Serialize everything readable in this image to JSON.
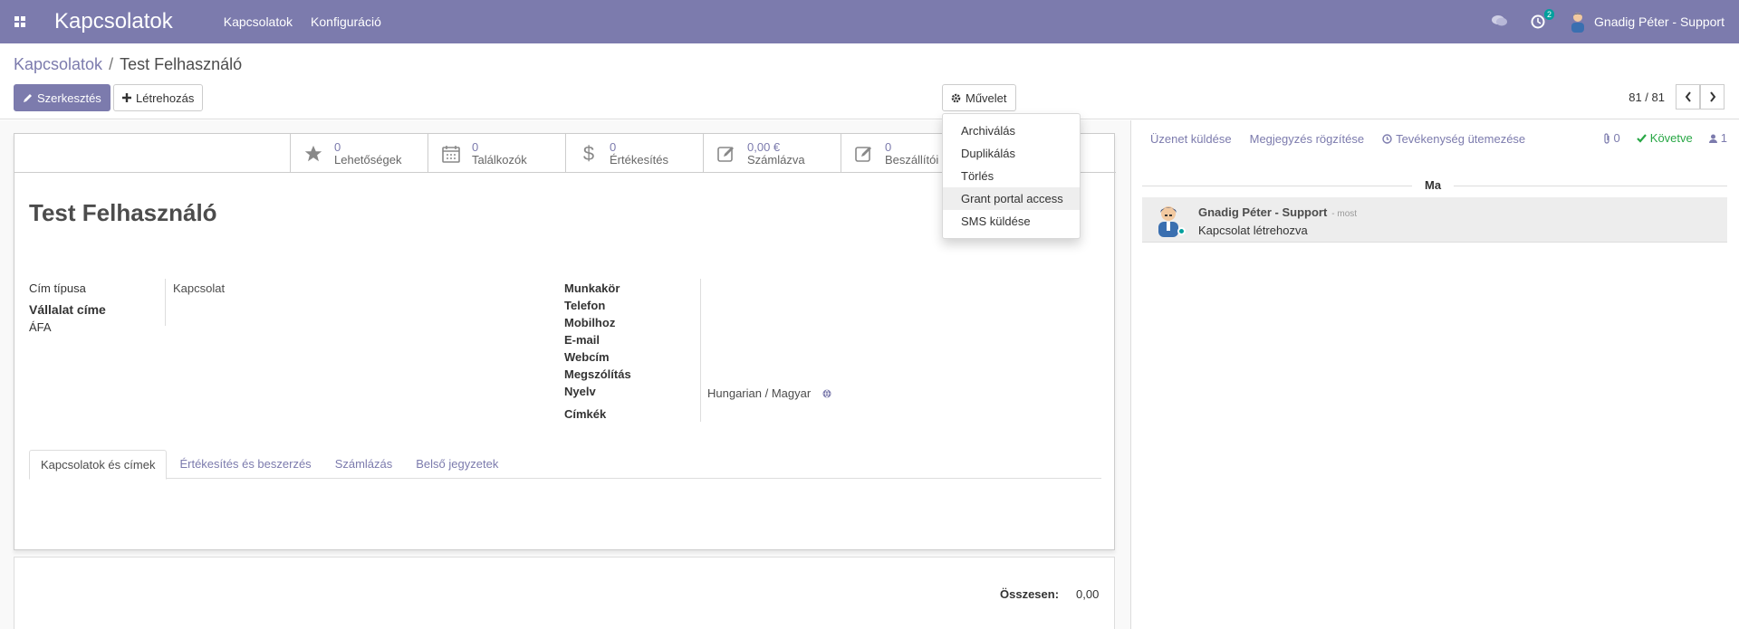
{
  "navbar": {
    "brand": "Kapcsolatok",
    "menu": [
      "Kapcsolatok",
      "Konfiguráció"
    ],
    "activity_count": "2",
    "user_name": "Gnadig Péter - Support"
  },
  "breadcrumb": {
    "parent": "Kapcsolatok",
    "current": "Test Felhasználó"
  },
  "buttons": {
    "edit": "Szerkesztés",
    "create": "Létrehozás",
    "action": "Művelet"
  },
  "pager": {
    "value": "81 / 81"
  },
  "action_menu": [
    "Archiválás",
    "Duplikálás",
    "Törlés",
    "Grant portal access",
    "SMS küldése"
  ],
  "stat_buttons": [
    {
      "value": "0",
      "label": "Lehetőségek",
      "icon": "star-icon"
    },
    {
      "value": "0",
      "label": "Találkozók",
      "icon": "calendar-icon"
    },
    {
      "value": "0",
      "label": "Értékesítés",
      "icon": "dollar-icon"
    },
    {
      "value": "0,00 €",
      "label": "Számlázva",
      "icon": "edit-icon"
    },
    {
      "value": "0",
      "label": "Beszállítói",
      "icon": "edit-icon"
    }
  ],
  "record": {
    "name": "Test Felhasználó",
    "left_labels": [
      "Cím típusa",
      "Vállalat címe",
      "ÁFA"
    ],
    "address_type": "Kapcsolat",
    "right_labels": [
      "Munkakör",
      "Telefon",
      "Mobilhoz",
      "E-mail",
      "Webcím",
      "Megszólítás",
      "Nyelv",
      "Címkék"
    ],
    "language": "Hungarian / Magyar"
  },
  "tabs": [
    "Kapcsolatok és címek",
    "Értékesítés és beszerzés",
    "Számlázás",
    "Belső jegyzetek"
  ],
  "total": {
    "label": "Összesen:",
    "value": "0,00"
  },
  "chatter": {
    "send_message": "Üzenet küldése",
    "log_note": "Megjegyzés rögzítése",
    "schedule_activity": "Tevékenység ütemezése",
    "attachments": "0",
    "following": "Követve",
    "followers": "1",
    "date_separator": "Ma",
    "message": {
      "author": "Gnadig Péter - Support",
      "time": "- most",
      "body": "Kapcsolat létrehozva"
    }
  },
  "colors": {
    "primary": "#7c7bad",
    "success": "#28a745",
    "teal": "#00a09d"
  }
}
